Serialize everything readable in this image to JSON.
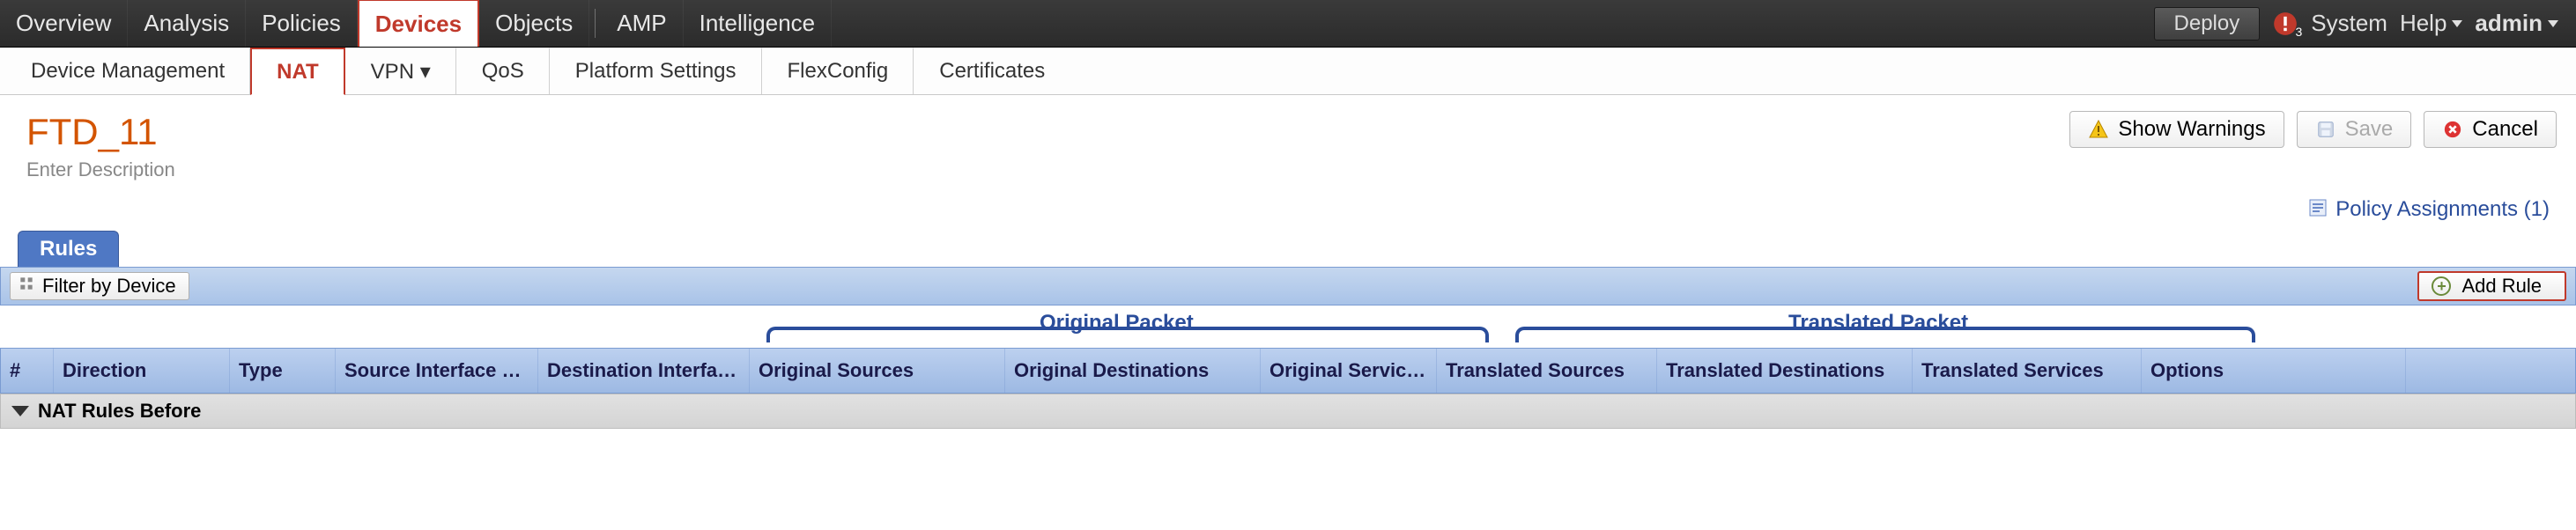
{
  "topmenu": {
    "items": [
      "Overview",
      "Analysis",
      "Policies",
      "Devices",
      "Objects"
    ],
    "items2": [
      "AMP",
      "Intelligence"
    ],
    "active": "Devices",
    "deploy": "Deploy",
    "alert_count": "3",
    "system": "System",
    "help": "Help",
    "user": "admin"
  },
  "subnav": {
    "items": [
      "Device Management",
      "NAT",
      "VPN ▾",
      "QoS",
      "Platform Settings",
      "FlexConfig",
      "Certificates"
    ],
    "active": "NAT"
  },
  "policy": {
    "title": "FTD_11",
    "description": "Enter Description",
    "show_warnings": "Show Warnings",
    "save": "Save",
    "cancel": "Cancel",
    "assignments_label": "Policy Assignments (1)"
  },
  "tabs": {
    "rules": "Rules"
  },
  "toolbar": {
    "filter": "Filter by Device",
    "add_rule": "Add Rule"
  },
  "groups": {
    "original": "Original Packet",
    "translated": "Translated Packet"
  },
  "columns": {
    "num": "#",
    "direction": "Direction",
    "type": "Type",
    "src_if": "Source Interface Ob...",
    "dst_if": "Destination Interface Ob...",
    "orig_src": "Original Sources",
    "orig_dst": "Original Destinations",
    "orig_svc": "Original Services",
    "tr_src": "Translated Sources",
    "tr_dst": "Translated Destinations",
    "tr_svc": "Translated Services",
    "options": "Options"
  },
  "sections": {
    "before": "NAT Rules Before"
  }
}
